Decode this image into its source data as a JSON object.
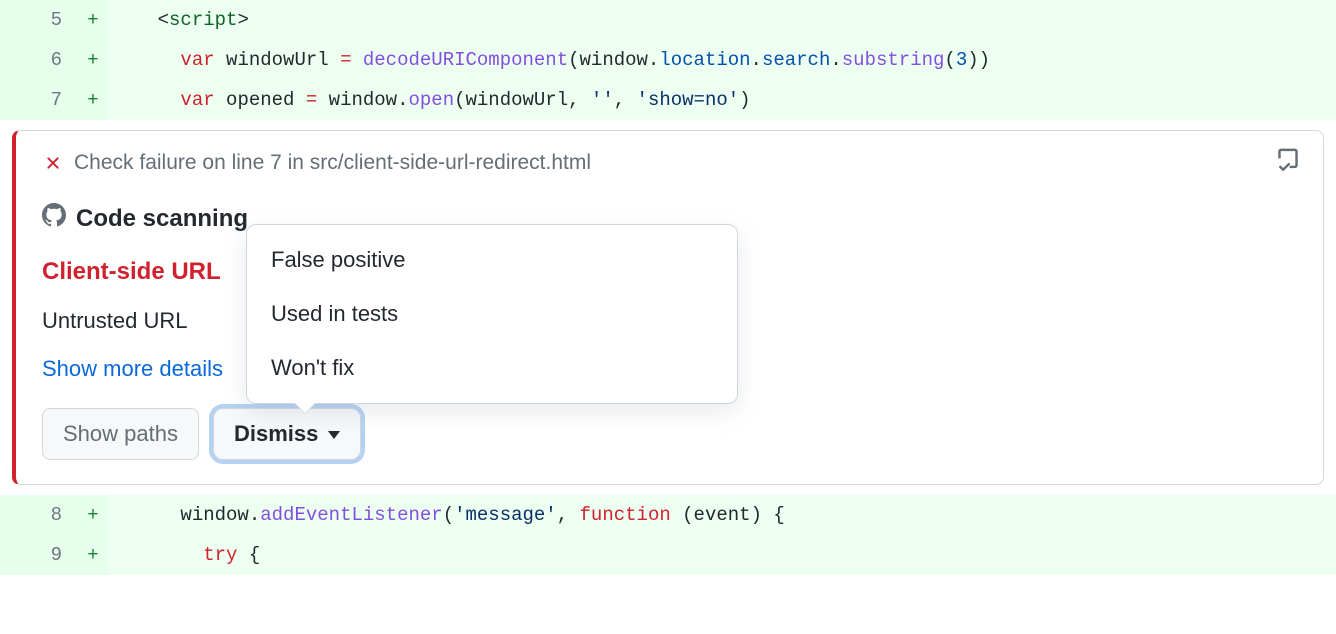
{
  "code": {
    "lines": [
      {
        "num": "5",
        "marker": "+",
        "indent": "    ",
        "tokens": [
          {
            "cls": "tok-plain",
            "t": "<"
          },
          {
            "cls": "tok-tag",
            "t": "script"
          },
          {
            "cls": "tok-plain",
            "t": ">"
          }
        ]
      },
      {
        "num": "6",
        "marker": "+",
        "indent": "      ",
        "tokens": [
          {
            "cls": "tok-kw",
            "t": "var"
          },
          {
            "cls": "tok-plain",
            "t": " windowUrl "
          },
          {
            "cls": "tok-kw",
            "t": "="
          },
          {
            "cls": "tok-plain",
            "t": " "
          },
          {
            "cls": "tok-fn",
            "t": "decodeURIComponent"
          },
          {
            "cls": "tok-plain",
            "t": "(window."
          },
          {
            "cls": "tok-attr",
            "t": "location"
          },
          {
            "cls": "tok-plain",
            "t": "."
          },
          {
            "cls": "tok-attr",
            "t": "search"
          },
          {
            "cls": "tok-plain",
            "t": "."
          },
          {
            "cls": "tok-fn",
            "t": "substring"
          },
          {
            "cls": "tok-plain",
            "t": "("
          },
          {
            "cls": "tok-num",
            "t": "3"
          },
          {
            "cls": "tok-plain",
            "t": "))"
          }
        ]
      },
      {
        "num": "7",
        "marker": "+",
        "indent": "      ",
        "tokens": [
          {
            "cls": "tok-kw",
            "t": "var"
          },
          {
            "cls": "tok-plain",
            "t": " opened "
          },
          {
            "cls": "tok-kw",
            "t": "="
          },
          {
            "cls": "tok-plain",
            "t": " window."
          },
          {
            "cls": "tok-fn",
            "t": "open"
          },
          {
            "cls": "tok-plain",
            "t": "(windowUrl, "
          },
          {
            "cls": "tok-str",
            "t": "''"
          },
          {
            "cls": "tok-plain",
            "t": ", "
          },
          {
            "cls": "tok-str",
            "t": "'show=no'"
          },
          {
            "cls": "tok-plain",
            "t": ")"
          }
        ]
      }
    ],
    "lines_after": [
      {
        "num": "8",
        "marker": "+",
        "indent": "      ",
        "tokens": [
          {
            "cls": "tok-plain",
            "t": "window."
          },
          {
            "cls": "tok-fn",
            "t": "addEventListener"
          },
          {
            "cls": "tok-plain",
            "t": "("
          },
          {
            "cls": "tok-str",
            "t": "'message'"
          },
          {
            "cls": "tok-plain",
            "t": ", "
          },
          {
            "cls": "tok-kw",
            "t": "function"
          },
          {
            "cls": "tok-plain",
            "t": " (event) {"
          }
        ]
      },
      {
        "num": "9",
        "marker": "+",
        "indent": "        ",
        "tokens": [
          {
            "cls": "tok-kw",
            "t": "try"
          },
          {
            "cls": "tok-plain",
            "t": " {"
          }
        ]
      }
    ]
  },
  "annotation": {
    "check_failure": "Check failure on line 7 in src/client-side-url-redirect.html",
    "scanner": "Code scanning",
    "title": "Client-side URL",
    "description": "Untrusted URL",
    "more": "Show more details"
  },
  "actions": {
    "show_paths": "Show paths",
    "dismiss": "Dismiss"
  },
  "dismiss_menu": {
    "items": [
      "False positive",
      "Used in tests",
      "Won't fix"
    ]
  }
}
